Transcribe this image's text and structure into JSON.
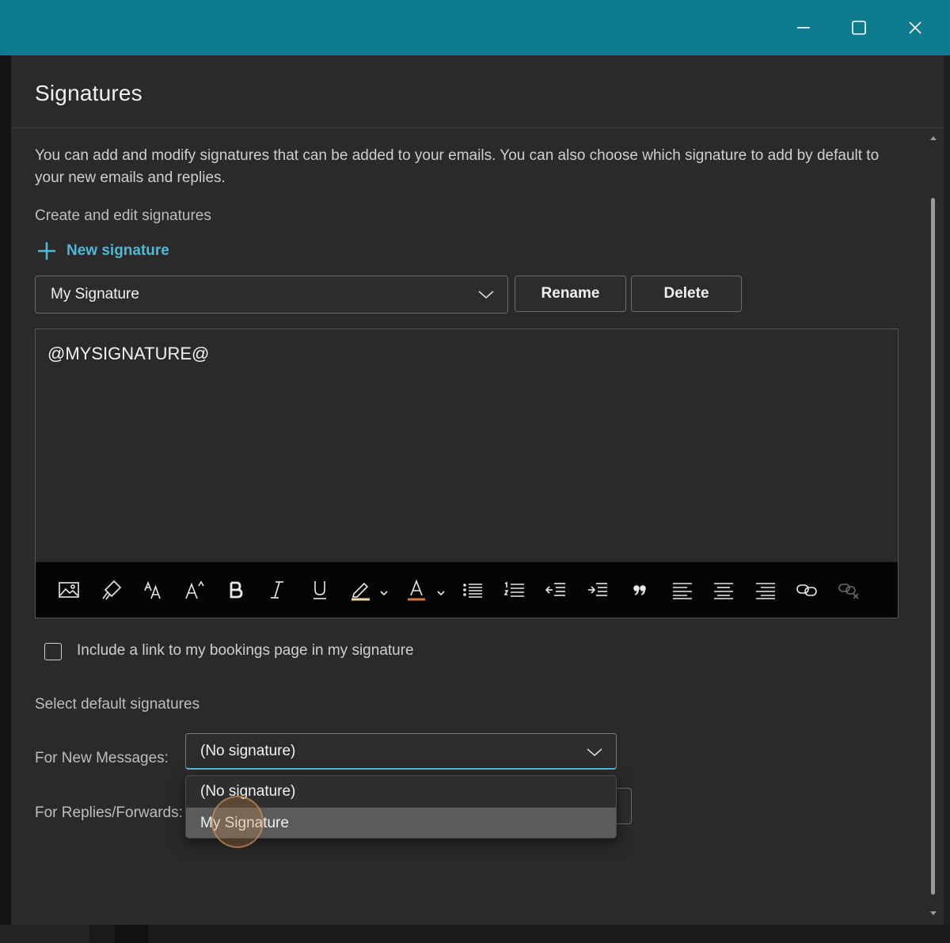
{
  "window": {
    "controls": {
      "minimize": "minimize-icon",
      "maximize": "maximize-icon",
      "close": "close-icon"
    }
  },
  "dialog": {
    "title": "Signatures",
    "description": "You can add and modify signatures that can be added to your emails. You can also choose which signature to add by default to your new emails and replies.",
    "create_label": "Create and edit signatures",
    "new_signature": "New signature",
    "selected_signature": "My Signature",
    "rename_label": "Rename",
    "delete_label": "Delete",
    "editor_content": "@MYSIGNATURE@",
    "toolbar_icons": [
      "insert-picture-icon",
      "format-painter-icon",
      "font-size-icon",
      "superscript-font-icon",
      "bold-icon",
      "italic-icon",
      "underline-icon",
      "highlight-icon",
      "font-color-icon",
      "bullets-icon",
      "numbering-icon",
      "decrease-indent-icon",
      "increase-indent-icon",
      "quote-icon",
      "align-left-icon",
      "align-center-icon",
      "align-right-icon",
      "insert-link-icon",
      "remove-link-icon"
    ],
    "bookings_checkbox_label": "Include a link to my bookings page in my signature",
    "bookings_checked": false,
    "default_section_label": "Select default signatures",
    "new_messages_label": "For New Messages:",
    "new_messages_value": "(No signature)",
    "replies_label": "For Replies/Forwards:",
    "dropdown_options": [
      "(No signature)",
      "My Signature"
    ],
    "dropdown_hovered": "My Signature"
  },
  "colors": {
    "titlebar": "#0f7b8f",
    "accent": "#4fb8d4",
    "dialog_bg": "#2a2a2a",
    "toolbar_bg": "#050505"
  }
}
